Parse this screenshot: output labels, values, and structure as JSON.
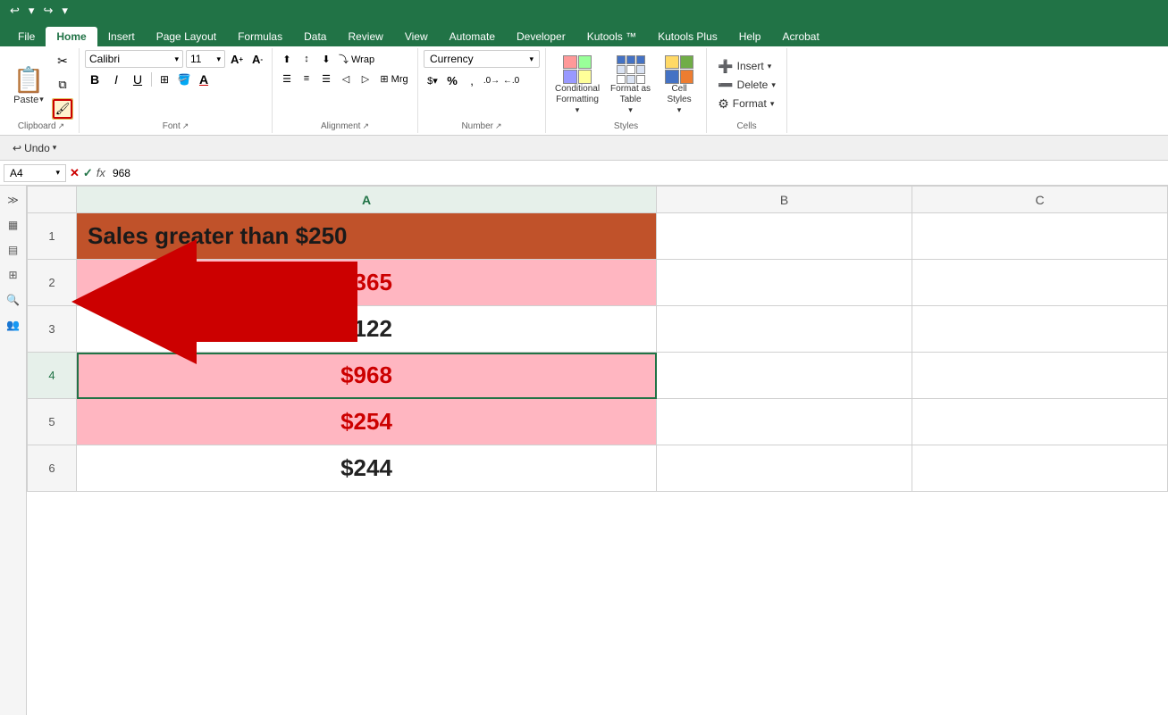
{
  "tabs": {
    "items": [
      "File",
      "Home",
      "Insert",
      "Page Layout",
      "Formulas",
      "Data",
      "Review",
      "View",
      "Automate",
      "Developer",
      "Kutools ™",
      "Kutools Plus",
      "Help",
      "Acrobat"
    ],
    "active": "Home"
  },
  "quick_access": {
    "undo_label": "↩",
    "redo_label": "↪",
    "more_label": "▾"
  },
  "undo_bar": {
    "undo_label": "↩ Undo",
    "undo_arrow": "▾"
  },
  "ribbon": {
    "clipboard": {
      "label": "Clipboard",
      "paste_label": "Paste",
      "cut_label": "✂",
      "copy_label": "⧉",
      "format_painter_label": "🖌"
    },
    "font": {
      "label": "Font",
      "font_name": "Calibri",
      "font_size": "11",
      "bold": "B",
      "italic": "I",
      "underline": "U",
      "grow": "A↑",
      "shrink": "A↓",
      "font_color": "A",
      "highlight": "⬛"
    },
    "alignment": {
      "label": "Alignment",
      "top_align": "⊤",
      "mid_align": "≡",
      "bot_align": "⊥",
      "left": "☰",
      "center": "≡",
      "right": "☰",
      "indent_dec": "◁",
      "indent_inc": "▷",
      "wrap": "⤵",
      "merge": "⊞",
      "dialog": "↗"
    },
    "number": {
      "label": "Number",
      "format_dropdown": "Currency",
      "percent": "%",
      "comma": ",",
      "increase_decimal": ".0→",
      "decrease_decimal": "←.0",
      "dialog": "↗"
    },
    "styles": {
      "label": "Styles",
      "conditional_label": "Conditional\nFormatting",
      "format_table_label": "Format as\nTable",
      "cell_styles_label": "Cell\nStyles"
    },
    "cells": {
      "label": "Cells",
      "insert_label": "Insert",
      "delete_label": "Delete",
      "format_label": "Format"
    }
  },
  "formula_bar": {
    "cell_ref": "A4",
    "formula_value": "968",
    "fx": "fx"
  },
  "spreadsheet": {
    "columns": [
      "",
      "A",
      "B",
      "C"
    ],
    "rows": [
      {
        "num": "1",
        "cells": [
          {
            "value": "Sales greater than $250",
            "bg": "#c0522a",
            "color": "#1a1a1a",
            "font_size": "26px",
            "align": "left",
            "bold": true
          }
        ]
      },
      {
        "num": "2",
        "cells": [
          {
            "value": "$365",
            "bg": "#ffb6c1",
            "color": "#cc0000",
            "font_size": "26px",
            "align": "center",
            "bold": true
          }
        ]
      },
      {
        "num": "3",
        "cells": [
          {
            "value": "$122",
            "bg": "white",
            "color": "#222",
            "font_size": "26px",
            "align": "center",
            "bold": true
          }
        ]
      },
      {
        "num": "4",
        "cells": [
          {
            "value": "$968",
            "bg": "#ffb6c1",
            "color": "#cc0000",
            "font_size": "26px",
            "align": "center",
            "bold": true,
            "selected": true
          }
        ]
      },
      {
        "num": "5",
        "cells": [
          {
            "value": "$254",
            "bg": "#ffb6c1",
            "color": "#cc0000",
            "font_size": "26px",
            "align": "center",
            "bold": true
          }
        ]
      },
      {
        "num": "6",
        "cells": [
          {
            "value": "$244",
            "bg": "white",
            "color": "#222",
            "font_size": "26px",
            "align": "center",
            "bold": true
          }
        ]
      }
    ]
  }
}
